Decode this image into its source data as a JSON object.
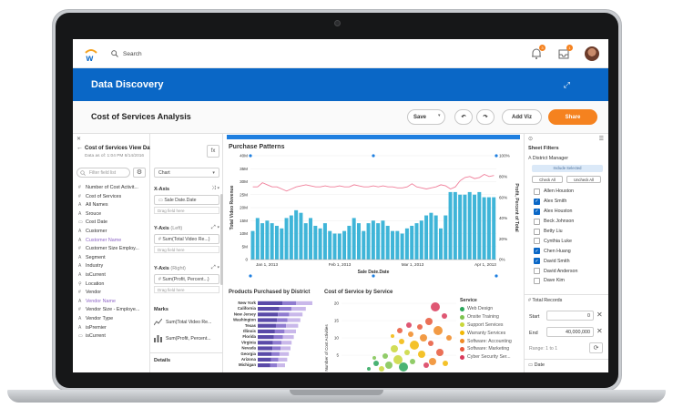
{
  "topbar": {
    "search_placeholder": "Search",
    "notif_count": "3",
    "inbox_count": "1"
  },
  "banner": {
    "title": "Data Discovery"
  },
  "analysis": {
    "title": "Cost of Services Analysis",
    "save_label": "Save",
    "add_viz_label": "Add Viz",
    "share_label": "Share"
  },
  "dataset": {
    "title": "Cost of Services View Dataset",
    "subtitle": "Data as of: 1:04 PM 8/14/2016",
    "fx_label": "fx",
    "filter_placeholder": "Filter field list",
    "fields": [
      {
        "type": "#",
        "label": "Number of Cost Activit...",
        "purple": false
      },
      {
        "type": "#",
        "label": "Cost of Services",
        "purple": false
      },
      {
        "type": "A",
        "label": "All Names",
        "purple": false
      },
      {
        "type": "A",
        "label": "Srouce",
        "purple": false
      },
      {
        "type": "▭",
        "label": "Cost Date",
        "purple": false
      },
      {
        "type": "A",
        "label": "Customer",
        "purple": false
      },
      {
        "type": "A",
        "label": "Customer Name",
        "purple": true
      },
      {
        "type": "#",
        "label": "Customer Size Employ...",
        "purple": false
      },
      {
        "type": "A",
        "label": "Segment",
        "purple": false
      },
      {
        "type": "A",
        "label": "Industry",
        "purple": false
      },
      {
        "type": "A",
        "label": "isCurrent",
        "purple": false
      },
      {
        "type": "⚲",
        "label": "Location",
        "purple": false
      },
      {
        "type": "#",
        "label": "Vendor",
        "purple": false
      },
      {
        "type": "A",
        "label": "Vendor Name",
        "purple": true
      },
      {
        "type": "#",
        "label": "Vendor Size - Employe...",
        "purple": false
      },
      {
        "type": "A",
        "label": "Vendor Type",
        "purple": false
      },
      {
        "type": "A",
        "label": "isPremier",
        "purple": false
      },
      {
        "type": "▭",
        "label": "isCurrent",
        "purple": false
      }
    ]
  },
  "config": {
    "chart_type": "Chart",
    "x_axis_label": "X-Axis",
    "x_axis_field": "Sale Date.Date",
    "drag_hint": "Drag field here",
    "y_left_label": "Y-Axis",
    "y_left_suffix": "(Left)",
    "y_left_field": "Sum(Total Video Re...)",
    "y_right_label": "Y-Axis",
    "y_right_suffix": "(Right)",
    "y_right_field": "Sum(Profit, Percent...)",
    "marks_label": "Marks",
    "mark1": "Sum(Total Video Re...",
    "mark2": "Sum(Profit, Percent...",
    "details_label": "Details"
  },
  "chart_data": [
    {
      "type": "bar",
      "title": "Purchase Patterns",
      "xlabel": "Sale Date.Date",
      "ylabel": "Total Video Revenue",
      "ylabel_right": "Profit, Percent of Total",
      "ylim": [
        0,
        40
      ],
      "y_ticks": [
        "0",
        "5M",
        "10M",
        "15M",
        "20M",
        "25M",
        "30M",
        "35M",
        "40M"
      ],
      "y_right_ticks": [
        "0%",
        "20%",
        "40%",
        "60%",
        "80%",
        "100%"
      ],
      "x_ticks": [
        "Jan 1, 2013",
        "Feb 1, 2013",
        "Mar 1, 2013",
        "Apr 1, 2013"
      ],
      "series": [
        {
          "values": [
            11,
            16,
            14,
            15,
            14,
            13,
            12,
            16,
            17,
            19,
            18,
            14,
            16,
            13,
            12,
            14,
            11,
            10,
            10,
            11,
            13,
            16,
            14,
            11,
            14,
            15,
            14,
            15,
            13,
            11,
            11,
            10,
            12,
            13,
            14,
            15,
            17,
            18,
            17,
            12,
            17,
            26,
            26,
            25,
            25,
            26,
            25,
            26,
            24,
            24,
            24
          ]
        },
        {
          "values": [
            70,
            70,
            74,
            72,
            70,
            70,
            68,
            66,
            68,
            70,
            71,
            72,
            71,
            70,
            70,
            71,
            70,
            70,
            71,
            70,
            70,
            72,
            71,
            70,
            70,
            71,
            70,
            71,
            70,
            70,
            69,
            69,
            70,
            73,
            70,
            69,
            68,
            69,
            70,
            72,
            71,
            68,
            70,
            76,
            79,
            80,
            78,
            79,
            82,
            80,
            81
          ]
        }
      ]
    },
    {
      "type": "bar",
      "title": "Products Purchased by District",
      "categories": [
        "New York",
        "California",
        "New Jersey",
        "Washington",
        "Texas",
        "Illinois",
        "Florida",
        "Virginia",
        "Nevada",
        "Georgia",
        "Arizona",
        "Michigan"
      ],
      "values": [
        100,
        88,
        82,
        78,
        74,
        70,
        66,
        62,
        60,
        57,
        54,
        50
      ]
    },
    {
      "type": "scatter",
      "title": "Cost of Service by Service",
      "ylabel": "Number of Cost Activities",
      "y_ticks": [
        "20",
        "15",
        "10",
        "5"
      ],
      "legend_title": "Service",
      "legend": [
        {
          "name": "Web Design",
          "color": "#2aa65a"
        },
        {
          "name": "Onsite Training",
          "color": "#7ec34f"
        },
        {
          "name": "Support Services",
          "color": "#c9d73a"
        },
        {
          "name": "Warranty Services",
          "color": "#f2b705"
        },
        {
          "name": "Software: Accounting",
          "color": "#f08a24"
        },
        {
          "name": "Software: Marketing",
          "color": "#e8573a"
        },
        {
          "name": "Cyber Security Ser...",
          "color": "#d93a5b"
        }
      ]
    }
  ],
  "filters": {
    "title": "Sheet Filters",
    "district_label": "District Manager",
    "include_label": "Include Selected",
    "check_all": "Check All",
    "uncheck_all": "Uncheck All",
    "managers": [
      {
        "name": "Allen Houston",
        "checked": false
      },
      {
        "name": "Alex Smith",
        "checked": true
      },
      {
        "name": "Alex Houston",
        "checked": true
      },
      {
        "name": "Beck Johnson",
        "checked": false
      },
      {
        "name": "Betty Liu",
        "checked": false
      },
      {
        "name": "Cynthia Luke",
        "checked": false
      },
      {
        "name": "Chen Huang",
        "checked": true
      },
      {
        "name": "David Smith",
        "checked": true
      },
      {
        "name": "David Anderson",
        "checked": false
      },
      {
        "name": "Dave Kim",
        "checked": false
      }
    ],
    "total_label": "Total Records",
    "start_label": "Start",
    "start_value": "0",
    "end_label": "End",
    "end_value": "40,000,000",
    "range_label": "Range: 1 to 1",
    "date_label": "Date"
  }
}
